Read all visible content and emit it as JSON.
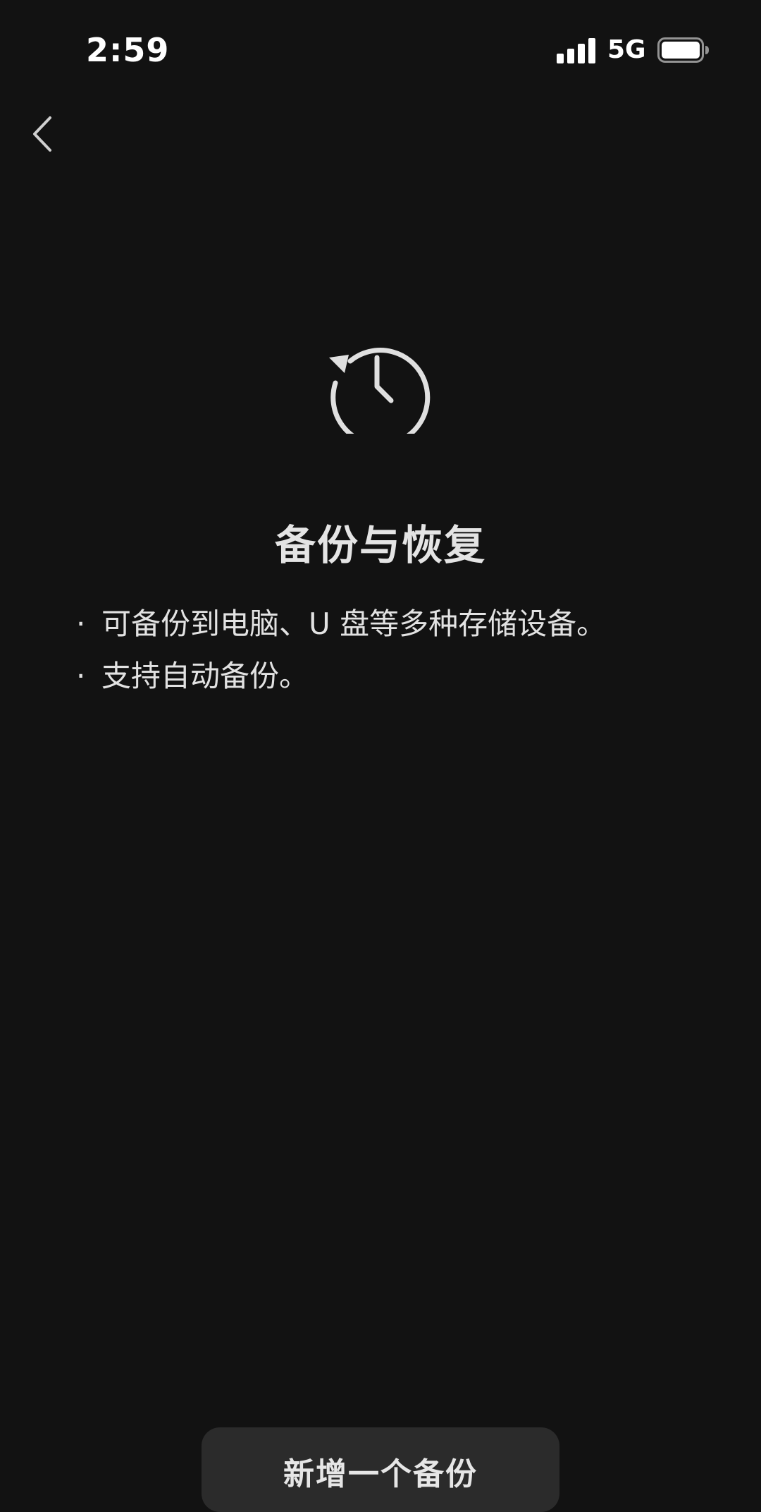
{
  "status_bar": {
    "time": "2:59",
    "network": "5G",
    "signal_icon": "cellular-signal-icon",
    "battery_icon": "battery-icon"
  },
  "nav": {
    "back_icon": "chevron-left-icon"
  },
  "hero": {
    "icon": "history-clock-icon",
    "title": "备份与恢复",
    "features": [
      "可备份到电脑、U 盘等多种存储设备。",
      "支持自动备份。"
    ],
    "bullet": "·"
  },
  "actions": {
    "add_backup_label": "新增一个备份"
  },
  "colors": {
    "background": "#121212",
    "text": "#e4e4e4",
    "button_bg": "#2b2b2b"
  }
}
